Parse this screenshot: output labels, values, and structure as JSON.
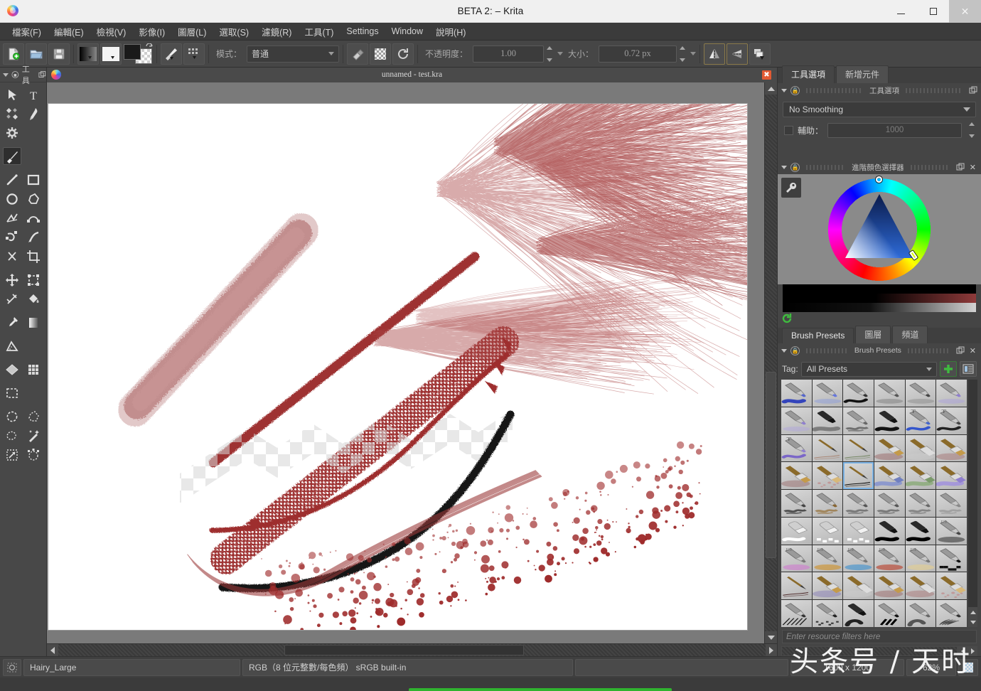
{
  "titlebar": {
    "app_icon": "krita-logo-icon",
    "title": "BETA 2:  – Krita",
    "minimize_label": "—",
    "maximize_label": "❑",
    "close_label": "✕"
  },
  "menubar": {
    "items": [
      {
        "label": "檔案(F)",
        "name": "menu-file"
      },
      {
        "label": "編輯(E)",
        "name": "menu-edit"
      },
      {
        "label": "檢視(V)",
        "name": "menu-view"
      },
      {
        "label": "影像(I)",
        "name": "menu-image"
      },
      {
        "label": "圖層(L)",
        "name": "menu-layer"
      },
      {
        "label": "選取(S)",
        "name": "menu-select"
      },
      {
        "label": "濾鏡(R)",
        "name": "menu-filter"
      },
      {
        "label": "工具(T)",
        "name": "menu-tools"
      },
      {
        "label": "Settings",
        "name": "menu-settings"
      },
      {
        "label": "Window",
        "name": "menu-window"
      },
      {
        "label": "說明(H)",
        "name": "menu-help"
      }
    ]
  },
  "toolbar": {
    "new_icon": "new-document-icon",
    "open_icon": "open-folder-icon",
    "save_icon": "save-disk-icon",
    "gradient_icon": "gradient-preset-icon",
    "pattern_icon": "pattern-preset-icon",
    "fgbg_icon": "foreground-background-color-icon",
    "brush_preset_icon": "brush-preset-icon",
    "brush_editor_icon": "brush-editor-icon",
    "mode_label": "模式：",
    "mode_value": "普通",
    "eraser_icon": "eraser-toggle-icon",
    "alpha_icon": "preserve-alpha-icon",
    "reload_icon": "reload-preset-icon",
    "opacity_label": "不透明度：",
    "opacity_value": "1.00",
    "size_label": "大小：",
    "size_value": "0.72 px",
    "mirror_h_icon": "mirror-horizontal-icon",
    "mirror_v_icon": "mirror-vertical-icon",
    "workspace_icon": "workspace-chooser-icon"
  },
  "toolbox": {
    "header_label": "工具",
    "header_caret_icon": "chevron-down-icon",
    "header_lock_icon": "lock-icon",
    "header_float_icon": "float-dock-icon",
    "tools": [
      {
        "name": "tool-shape-select",
        "icon": "cursor-arrow-icon",
        "active": false
      },
      {
        "name": "tool-text",
        "icon": "text-t-icon",
        "active": false
      },
      {
        "name": "tool-edit-shapes",
        "icon": "edit-shapes-icon",
        "active": false
      },
      {
        "name": "tool-calligraphy",
        "icon": "calligraphy-pen-icon",
        "active": false
      },
      {
        "name": "tool-gradient-edit",
        "icon": "gear-icon",
        "active": false
      },
      {
        "name": "tool-freehand-brush",
        "icon": "paintbrush-icon",
        "active": true
      },
      {
        "name": "tool-line",
        "icon": "line-icon",
        "active": false
      },
      {
        "name": "tool-rectangle",
        "icon": "rectangle-icon",
        "active": false
      },
      {
        "name": "tool-ellipse",
        "icon": "ellipse-icon",
        "active": false
      },
      {
        "name": "tool-polygon",
        "icon": "polygon-icon",
        "active": false
      },
      {
        "name": "tool-polyline",
        "icon": "polyline-icon",
        "active": false
      },
      {
        "name": "tool-bezier-curve",
        "icon": "bezier-curve-icon",
        "active": false
      },
      {
        "name": "tool-freehand-path",
        "icon": "freehand-path-icon",
        "active": false
      },
      {
        "name": "tool-dynamic-brush",
        "icon": "dynamic-brush-icon",
        "active": false
      },
      {
        "name": "tool-multibrush",
        "icon": "multibrush-icon",
        "active": false
      },
      {
        "name": "tool-crop",
        "icon": "crop-icon",
        "active": false
      },
      {
        "name": "tool-move",
        "icon": "move-cross-icon",
        "active": false
      },
      {
        "name": "tool-transform",
        "icon": "transform-icon",
        "active": false
      },
      {
        "name": "tool-measure",
        "icon": "assistant-edit-icon",
        "active": false
      },
      {
        "name": "tool-fill",
        "icon": "paint-bucket-icon",
        "active": false
      },
      {
        "name": "tool-color-picker",
        "icon": "eyedropper-icon",
        "active": false
      },
      {
        "name": "tool-gradient",
        "icon": "gradient-bar-icon",
        "active": false
      },
      {
        "name": "tool-measure-ruler",
        "icon": "ruler-icon",
        "active": false
      },
      {
        "name": "tool-perspective",
        "icon": "perspective-grid-icon",
        "active": false
      },
      {
        "name": "tool-grid",
        "icon": "grid-icon",
        "active": false
      },
      {
        "name": "tool-rect-select",
        "icon": "rectangular-selection-icon",
        "active": false
      },
      {
        "name": "tool-ellipse-select",
        "icon": "elliptical-selection-icon",
        "active": false
      },
      {
        "name": "tool-polygon-select",
        "icon": "polygonal-selection-icon",
        "active": false
      },
      {
        "name": "tool-freehand-select",
        "icon": "freehand-selection-icon",
        "active": false
      },
      {
        "name": "tool-contiguous-select",
        "icon": "magic-wand-selection-icon",
        "active": false
      },
      {
        "name": "tool-similar-select",
        "icon": "similar-color-selection-icon",
        "active": false
      },
      {
        "name": "tool-bezier-select",
        "icon": "bezier-selection-icon",
        "active": false
      }
    ]
  },
  "document_tab": {
    "icon": "krita-document-icon",
    "title": "unnamed - test.kra",
    "close_label": "✖"
  },
  "canvas": {
    "paper_color": "#ffffff",
    "background_color": "#7a7a7a",
    "vscroll": {
      "up_icon": "scroll-up-icon",
      "down_icon": "scroll-down-icon"
    },
    "hscroll": {
      "left_icon": "scroll-left-icon",
      "right_icon": "scroll-right-icon"
    }
  },
  "dock": {
    "top_tabs": [
      {
        "label": "工具選項",
        "name": "tab-tool-options",
        "selected": true
      },
      {
        "label": "新增元件",
        "name": "tab-add-widget",
        "selected": false
      }
    ],
    "tool_options": {
      "panel_title": "工具選項",
      "smoothing_value": "No Smoothing",
      "assistant_label": "輔助：",
      "assistant_value": "1000",
      "caret_icon": "chevron-down-icon",
      "lock_icon": "lock-icon",
      "float_icon": "float-dock-icon"
    },
    "color_selector": {
      "panel_title": "進階顏色選擇器",
      "settings_icon": "wrench-icon",
      "reset_icon": "reset-color-icon",
      "caret_icon": "chevron-down-icon",
      "lock_icon": "lock-icon",
      "float_icon": "float-dock-icon",
      "close_icon": "close-icon",
      "selected_color": "#8e3a3a"
    },
    "bottom_tabs": [
      {
        "label": "Brush Presets",
        "name": "tab-brush-presets",
        "selected": true
      },
      {
        "label": "圖層",
        "name": "tab-layers",
        "selected": false
      },
      {
        "label": "頻道",
        "name": "tab-channels",
        "selected": false
      }
    ],
    "brush_presets": {
      "panel_title": "Brush Presets",
      "tag_label": "Tag:",
      "tag_value": "All Presets",
      "add_icon": "plus-icon",
      "view_icon": "list-view-icon",
      "filter_placeholder": "Enter resource filters here",
      "caret_icon": "chevron-down-icon",
      "lock_icon": "lock-icon",
      "float_icon": "float-dock-icon",
      "close_icon": "close-icon",
      "selected_index": 20,
      "items": [
        {
          "type": "pen",
          "tip": "#5566cc",
          "stroke": "#3344bb",
          "sw": "blob",
          "badge": ""
        },
        {
          "type": "pen",
          "tip": "#6677dd",
          "stroke": "#8899dd",
          "sw": "soft",
          "badge": ""
        },
        {
          "type": "pen",
          "tip": "#333333",
          "stroke": "#111111",
          "sw": "wave",
          "badge": ""
        },
        {
          "type": "pen",
          "tip": "#555555",
          "stroke": "#777777",
          "sw": "soft",
          "badge": ""
        },
        {
          "type": "pen",
          "tip": "#444444",
          "stroke": "#888888",
          "sw": "soft",
          "badge": ""
        },
        {
          "type": "pen",
          "tip": "#8f7ecf",
          "stroke": "#a99ddd",
          "sw": "soft",
          "badge": ""
        },
        {
          "type": "pen",
          "tip": "#8f7ecf",
          "stroke": "#b0a5e0",
          "sw": "soft",
          "badge": ""
        },
        {
          "type": "marker",
          "tip": "#777777",
          "stroke": "#6b6b6b",
          "sw": "flat",
          "badge": ""
        },
        {
          "type": "pen",
          "tip": "#666666",
          "stroke": "#5a5a5a",
          "sw": "rough",
          "badge": ""
        },
        {
          "type": "marker",
          "tip": "#222222",
          "stroke": "#111111",
          "sw": "blob",
          "badge": ""
        },
        {
          "type": "pen",
          "tip": "#4466cc",
          "stroke": "#3355cc",
          "sw": "wave",
          "badge": "T"
        },
        {
          "type": "pen",
          "tip": "#444444",
          "stroke": "#222222",
          "sw": "wave",
          "badge": "T"
        },
        {
          "type": "pen",
          "tip": "#8f7ecf",
          "stroke": "#7a66c8",
          "sw": "wave",
          "badge": "T"
        },
        {
          "type": "thin",
          "tip": "#aa7766",
          "stroke": "#aa8877",
          "sw": "thin",
          "badge": ""
        },
        {
          "type": "thin",
          "tip": "#667755",
          "stroke": "#778866",
          "sw": "thin",
          "badge": ""
        },
        {
          "type": "flat",
          "tip": "#c49a4a",
          "stroke": "#9b6a6a",
          "sw": "smudge",
          "badge": ""
        },
        {
          "type": "flat",
          "tip": "#dddddd",
          "stroke": "#cccccc",
          "sw": "smudge",
          "badge": ""
        },
        {
          "type": "flat",
          "tip": "#c49a4a",
          "stroke": "#a87878",
          "sw": "smudge",
          "badge": ""
        },
        {
          "type": "flat",
          "tip": "#c49a4a",
          "stroke": "#9b7070",
          "sw": "smudge",
          "badge": ""
        },
        {
          "type": "sponge",
          "tip": "#d8b878",
          "stroke": "#c08888",
          "sw": "speckle",
          "badge": ""
        },
        {
          "type": "thin",
          "tip": "#222222",
          "stroke": "#111111",
          "sw": "thin",
          "badge": ""
        },
        {
          "type": "flat",
          "tip": "#6f7fc0",
          "stroke": "#7f8fd0",
          "sw": "flat",
          "badge": ""
        },
        {
          "type": "flat",
          "tip": "#7a9a6a",
          "stroke": "#88aa77",
          "sw": "flat",
          "badge": ""
        },
        {
          "type": "flat",
          "tip": "#8f7ecf",
          "stroke": "#9f8edf",
          "sw": "flat",
          "badge": ""
        },
        {
          "type": "pen",
          "tip": "#444444",
          "stroke": "#333333",
          "sw": "rough",
          "badge": ""
        },
        {
          "type": "pen",
          "tip": "#886633",
          "stroke": "#997744",
          "sw": "rough",
          "badge": ""
        },
        {
          "type": "pen",
          "tip": "#555555",
          "stroke": "#666666",
          "sw": "rough",
          "badge": ""
        },
        {
          "type": "pen",
          "tip": "#555555",
          "stroke": "#666666",
          "sw": "rough",
          "badge": ""
        },
        {
          "type": "pen",
          "tip": "#666666",
          "stroke": "#777777",
          "sw": "rough",
          "badge": ""
        },
        {
          "type": "pen",
          "tip": "#888888",
          "stroke": "#999999",
          "sw": "rough",
          "badge": ""
        },
        {
          "type": "eraser",
          "tip": "#dddddd",
          "stroke": "#ffffff",
          "sw": "white",
          "badge": ""
        },
        {
          "type": "eraser",
          "tip": "#eeeeee",
          "stroke": "#ffffff",
          "sw": "checker",
          "badge": ""
        },
        {
          "type": "eraser",
          "tip": "#aaaaaa",
          "stroke": "#ffffff",
          "sw": "checker",
          "badge": ""
        },
        {
          "type": "marker",
          "tip": "#111111",
          "stroke": "#000000",
          "sw": "blob",
          "badge": ""
        },
        {
          "type": "marker",
          "tip": "#111111",
          "stroke": "#000000",
          "sw": "blob",
          "badge": ""
        },
        {
          "type": "pen",
          "tip": "#444444",
          "stroke": "#555555",
          "sw": "ellipse",
          "badge": "□"
        },
        {
          "type": "pen",
          "tip": "#777777",
          "stroke": "#cc88cc",
          "sw": "ellipse",
          "badge": "□"
        },
        {
          "type": "pen",
          "tip": "#777777",
          "stroke": "#cc9944",
          "sw": "ellipse",
          "badge": "□"
        },
        {
          "type": "pen",
          "tip": "#777777",
          "stroke": "#5599cc",
          "sw": "ellipse",
          "badge": "□"
        },
        {
          "type": "pen",
          "tip": "#777777",
          "stroke": "#bb5544",
          "sw": "ellipse",
          "badge": "□"
        },
        {
          "type": "pen",
          "tip": "#777777",
          "stroke": "#ddcc99",
          "sw": "ellipse",
          "badge": "□"
        },
        {
          "type": "pixel",
          "tip": "#111111",
          "stroke": "#000000",
          "sw": "pixel",
          "badge": ""
        },
        {
          "type": "thin",
          "tip": "#333333",
          "stroke": "#553333",
          "sw": "thin",
          "badge": ""
        },
        {
          "type": "flat",
          "tip": "#c49a4a",
          "stroke": "#8a7fb8",
          "sw": "smudge",
          "badge": ""
        },
        {
          "type": "flat",
          "tip": "#dddddd",
          "stroke": "#cccccc",
          "sw": "smudge",
          "badge": ""
        },
        {
          "type": "flat",
          "tip": "#c49a4a",
          "stroke": "#9b6a6a",
          "sw": "smudge",
          "badge": ""
        },
        {
          "type": "flat",
          "tip": "#dddddd",
          "stroke": "#aa7777",
          "sw": "smudge",
          "badge": ""
        },
        {
          "type": "sponge",
          "tip": "#d8b878",
          "stroke": "#c08888",
          "sw": "speckle",
          "badge": ""
        },
        {
          "type": "hatch",
          "tip": "#333333",
          "stroke": "#222222",
          "sw": "hatch",
          "badge": ""
        },
        {
          "type": "dither",
          "tip": "#222222",
          "stroke": "#111111",
          "sw": "dither",
          "badge": ""
        },
        {
          "type": "marker",
          "tip": "#333333",
          "stroke": "#222222",
          "sw": "hook",
          "badge": ""
        },
        {
          "type": "stripe",
          "tip": "#111111",
          "stroke": "#000000",
          "sw": "stripe",
          "badge": ""
        },
        {
          "type": "checker",
          "tip": "#666666",
          "stroke": "#555555",
          "sw": "hook",
          "badge": ""
        },
        {
          "type": "fuzz",
          "tip": "#333333",
          "stroke": "#222222",
          "sw": "fuzz",
          "badge": ""
        }
      ]
    },
    "dock_hscroll": {
      "left_icon": "scroll-left-icon",
      "right_icon": "scroll-right-icon"
    }
  },
  "statusbar": {
    "selection_icon": "selection-mask-icon",
    "brush_name": "Hairy_Large",
    "color_profile": "RGB（8 位元整數/每色頻） sRGB built-in",
    "dimensions": "1600 x 1200",
    "zoom": "62%",
    "picker_icon": "checker-swatch-icon"
  },
  "watermark": {
    "text": "头条号 / 天时"
  }
}
